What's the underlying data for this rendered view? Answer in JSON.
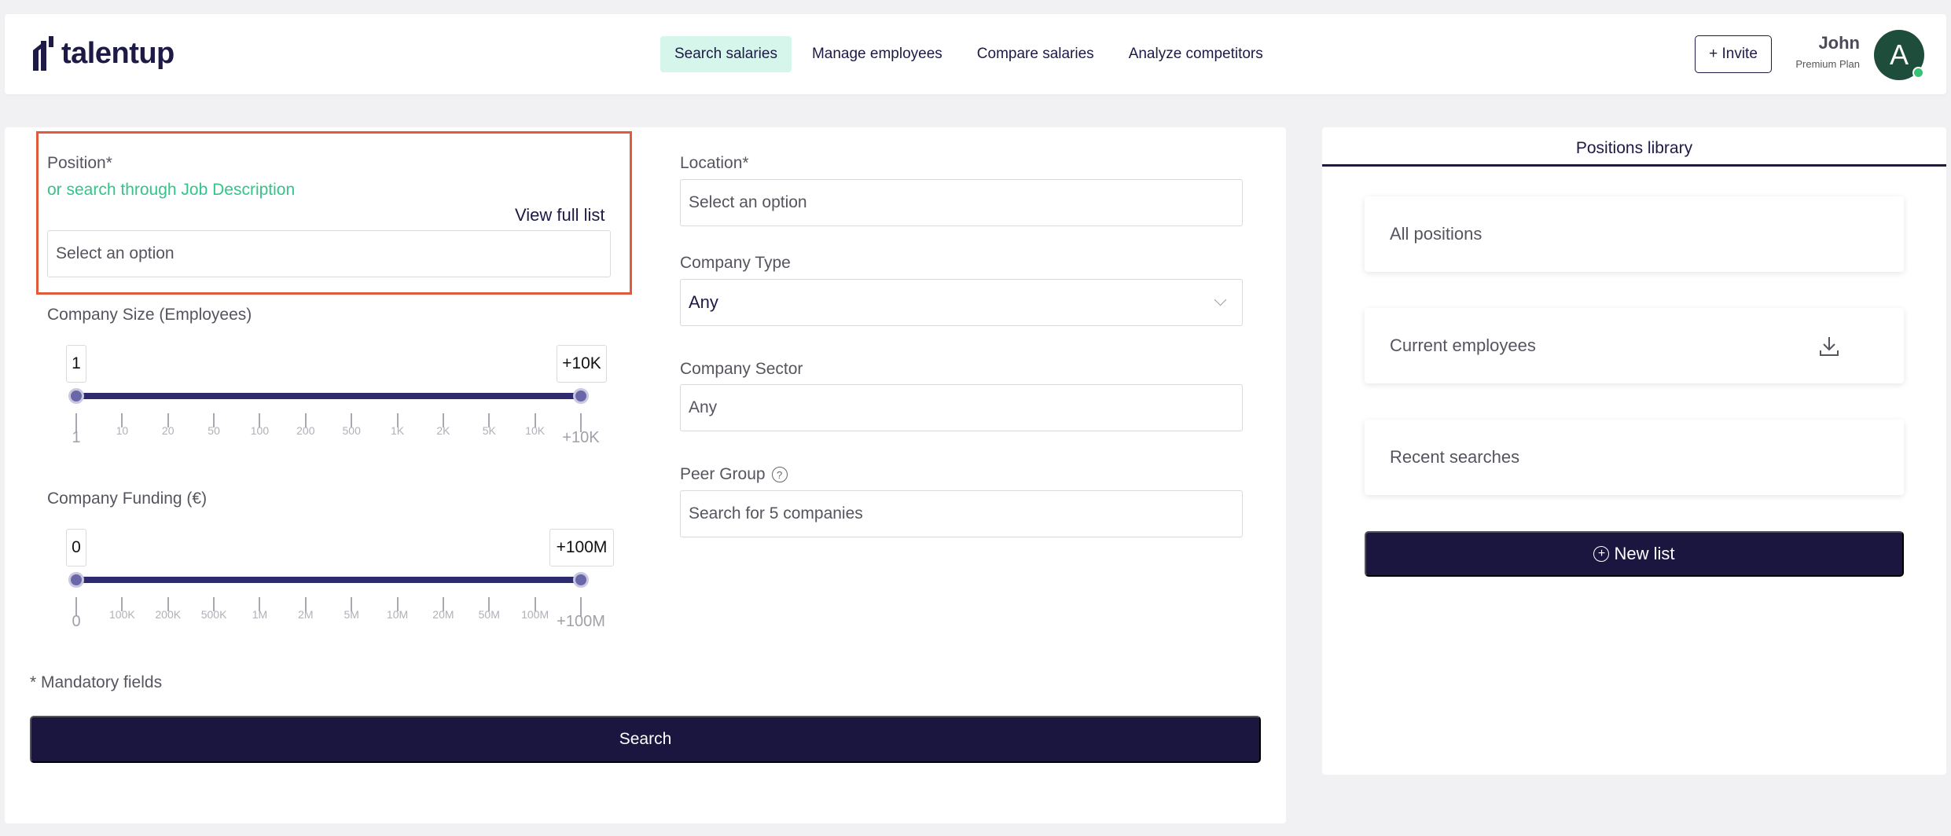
{
  "app": {
    "brand": "talentup"
  },
  "nav": {
    "items": [
      {
        "label": "Search salaries",
        "active": true
      },
      {
        "label": "Manage employees",
        "active": false
      },
      {
        "label": "Compare salaries",
        "active": false
      },
      {
        "label": "Analyze competitors",
        "active": false
      }
    ],
    "invite_label": "+ Invite"
  },
  "user": {
    "name": "John",
    "plan": "Premium Plan",
    "avatar_initial": "A",
    "status_color": "#36c373"
  },
  "form": {
    "position": {
      "label": "Position*",
      "jd_link": "or search through Job Description",
      "view_full_list": "View full list",
      "placeholder": "Select an option"
    },
    "location": {
      "label": "Location*",
      "placeholder": "Select an option"
    },
    "company_type": {
      "label": "Company Type",
      "value": "Any"
    },
    "company_sector": {
      "label": "Company Sector",
      "placeholder": "Any"
    },
    "peer_group": {
      "label": "Peer Group",
      "help_icon": "question-circle-icon",
      "placeholder": "Search for 5 companies"
    },
    "company_size": {
      "label": "Company Size (Employees)",
      "min_value": "1",
      "max_value": "+10K",
      "range_start_fraction": 0,
      "range_end_fraction": 1,
      "start_label": "1",
      "end_label": "+10K",
      "ticks": [
        "10",
        "20",
        "50",
        "100",
        "200",
        "500",
        "1K",
        "2K",
        "5K",
        "10K"
      ]
    },
    "company_funding": {
      "label": "Company Funding (€)",
      "min_value": "0",
      "max_value": "+100M",
      "range_start_fraction": 0,
      "range_end_fraction": 1,
      "start_label": "0",
      "end_label": "+100M",
      "ticks": [
        "100K",
        "200K",
        "500K",
        "1M",
        "2M",
        "5M",
        "10M",
        "20M",
        "50M",
        "100M"
      ]
    },
    "mandatory_note": "* Mandatory fields",
    "search_label": "Search"
  },
  "library": {
    "tab": "Positions library",
    "items": [
      {
        "label": "All positions"
      },
      {
        "label": "Current employees",
        "icon": "download-icon"
      },
      {
        "label": "Recent searches"
      }
    ],
    "new_list_label": "New list"
  },
  "colors": {
    "accent_dark": "#1b1640",
    "accent_green": "#33c48a",
    "highlight": "#e05a3c"
  }
}
